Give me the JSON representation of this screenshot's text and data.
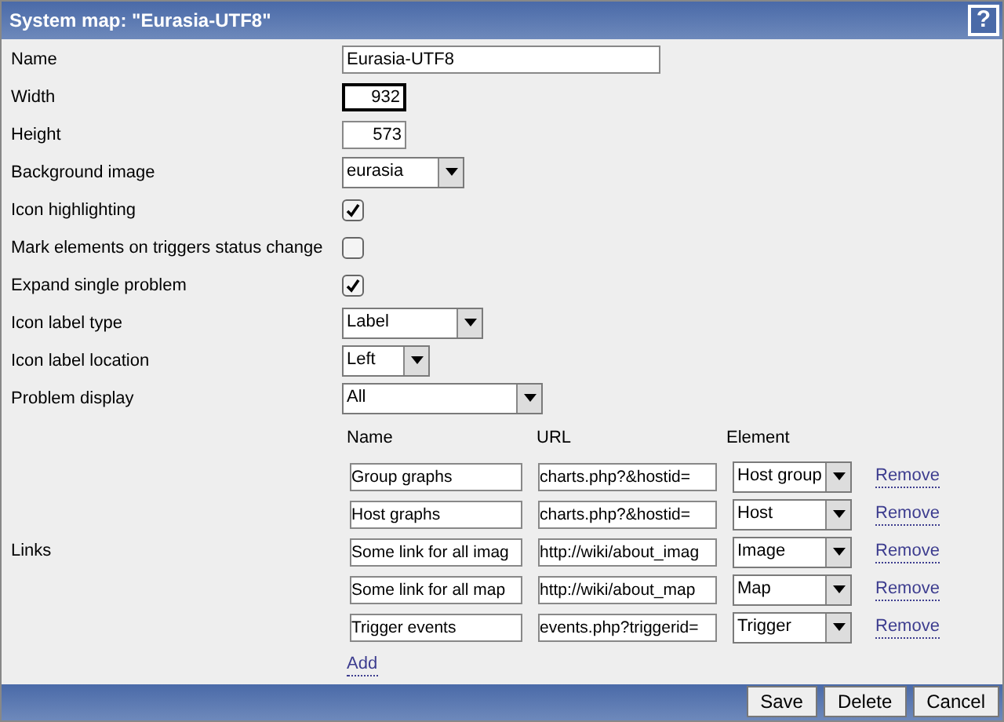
{
  "window": {
    "title": "System map: \"Eurasia-UTF8\"",
    "help": "?"
  },
  "fields": [
    {
      "label": "Name",
      "kind": "text",
      "value": "Eurasia-UTF8"
    },
    {
      "label": "Width",
      "kind": "number",
      "value": "932",
      "focused": true
    },
    {
      "label": "Height",
      "kind": "number",
      "value": "573",
      "focused": false
    },
    {
      "label": "Background image",
      "kind": "select",
      "value": "eurasia"
    },
    {
      "label": "Icon highlighting",
      "kind": "checkbox",
      "checked": true
    },
    {
      "label": "Mark elements on triggers status change",
      "kind": "checkbox",
      "checked": false
    },
    {
      "label": "Expand single problem",
      "kind": "checkbox",
      "checked": true
    },
    {
      "label": "Icon label type",
      "kind": "select",
      "value": "Label"
    },
    {
      "label": "Icon label location",
      "kind": "select",
      "value": "Left"
    },
    {
      "label": "Problem display",
      "kind": "select",
      "value": "All"
    }
  ],
  "links": {
    "label": "Links",
    "columns": [
      "Name",
      "URL",
      "Element"
    ],
    "rows": [
      {
        "name": "Group graphs",
        "url": "charts.php?&hostid=",
        "element": "Host group",
        "action": "Remove"
      },
      {
        "name": "Host graphs",
        "url": "charts.php?&hostid=",
        "element": "Host",
        "action": "Remove"
      },
      {
        "name": "Some link for all imag",
        "url": "http://wiki/about_imag",
        "element": "Image",
        "action": "Remove"
      },
      {
        "name": "Some link for all map",
        "url": "http://wiki/about_map",
        "element": "Map",
        "action": "Remove"
      },
      {
        "name": "Trigger events",
        "url": "events.php?triggerid=",
        "element": "Trigger",
        "action": "Remove"
      }
    ],
    "add": "Add"
  },
  "buttons": [
    "Save",
    "Delete",
    "Cancel"
  ]
}
